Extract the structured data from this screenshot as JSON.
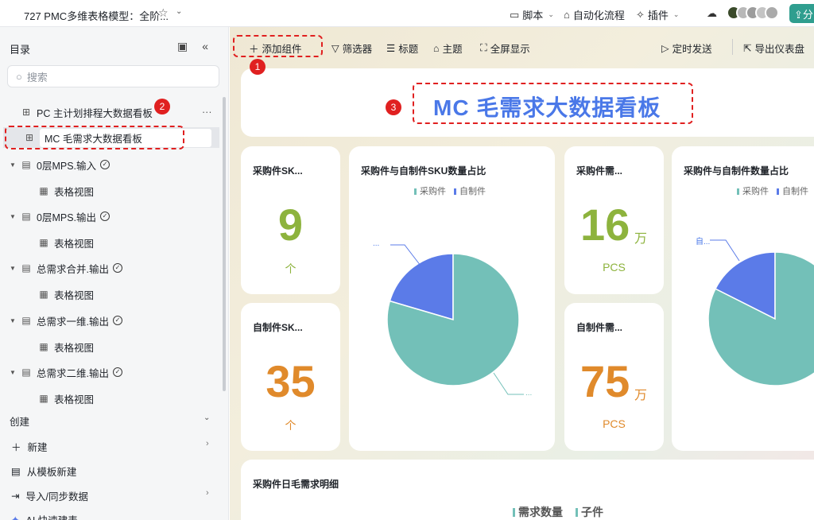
{
  "topbar": {
    "title": "727 PMC多维表格模型：全阶...",
    "script_label": "脚本",
    "automation_label": "自动化流程",
    "plugin_label": "插件",
    "share_label": "分"
  },
  "sidebar": {
    "header": "目录",
    "search_placeholder": "搜索",
    "items": [
      {
        "label": "PC 主计划排程大数据看板",
        "type": "dashboard"
      },
      {
        "label": "MC 毛需求大数据看板",
        "type": "dashboard"
      },
      {
        "label": "0层MPS.输入",
        "type": "table"
      },
      {
        "label": "表格视图",
        "type": "view"
      },
      {
        "label": "0层MPS.输出",
        "type": "table"
      },
      {
        "label": "表格视图",
        "type": "view"
      },
      {
        "label": "总需求合并.输出",
        "type": "table"
      },
      {
        "label": "表格视图",
        "type": "view"
      },
      {
        "label": "总需求一维.输出",
        "type": "table"
      },
      {
        "label": "表格视图",
        "type": "view"
      },
      {
        "label": "总需求二维.输出",
        "type": "table"
      },
      {
        "label": "表格视图",
        "type": "view"
      }
    ],
    "create_header": "创建",
    "create_items": [
      "新建",
      "从模板新建",
      "导入/同步数据",
      "AI 快速建表"
    ]
  },
  "annotations": [
    "1",
    "2",
    "3"
  ],
  "toolbar": {
    "add_widget": "添加组件",
    "filter": "筛选器",
    "title": "标题",
    "theme": "主题",
    "fullscreen": "全屏显示",
    "schedule_send": "定时发送",
    "export": "导出仪表盘"
  },
  "dashboard": {
    "title": "MC 毛需求大数据看板",
    "kpis": [
      {
        "title": "采购件SK...",
        "value": "9",
        "unit": "个",
        "color": "#8db33d"
      },
      {
        "title": "自制件SK...",
        "value": "35",
        "unit": "个",
        "color": "#e08a2b"
      },
      {
        "title": "采购件需...",
        "value": "16",
        "suffix": "万",
        "unit": "PCS",
        "color": "#8db33d"
      },
      {
        "title": "自制件需...",
        "value": "75",
        "suffix": "万",
        "unit": "PCS",
        "color": "#e08a2b"
      }
    ],
    "pie1": {
      "title": "采购件与自制件SKU数量占比",
      "legend": [
        "采购件",
        "自制件"
      ],
      "label_a": "...",
      "label_b": "..."
    },
    "pie2": {
      "title": "采购件与自制件数量占比",
      "legend": [
        "采购件",
        "自制件"
      ],
      "label_a": "自..."
    },
    "bottom_title": "采购件日毛需求明细",
    "bottom_legend": [
      "需求数量",
      "子件"
    ]
  },
  "chart_data": [
    {
      "type": "pie",
      "title": "采购件与自制件SKU数量占比",
      "categories": [
        "采购件",
        "自制件"
      ],
      "values": [
        35,
        9
      ],
      "colors": [
        "#73c0b8",
        "#5b7be8"
      ]
    },
    {
      "type": "pie",
      "title": "采购件与自制件数量占比",
      "categories": [
        "采购件",
        "自制件"
      ],
      "values": [
        75,
        16
      ],
      "colors": [
        "#73c0b8",
        "#5b7be8"
      ]
    }
  ],
  "colors": {
    "accent": "#4a78e8",
    "teal": "#73c0b8",
    "red": "#e02020",
    "share": "#2f9e8f"
  }
}
